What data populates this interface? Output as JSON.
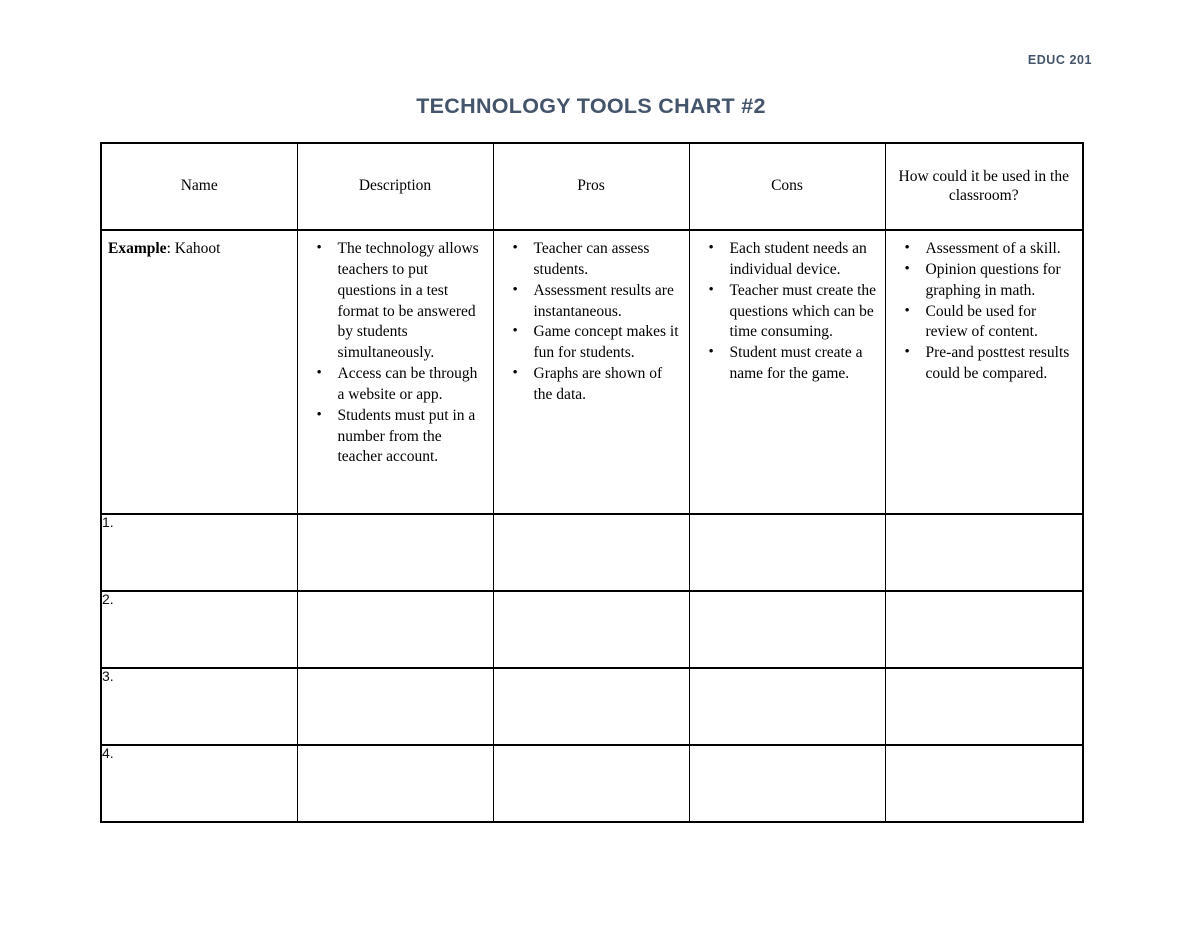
{
  "header": {
    "course_code": "EDUC 201"
  },
  "title": "TECHNOLOGY TOOLS CHART #2",
  "colors": {
    "accent": "#44546A",
    "text": "#000000",
    "border": "#000000",
    "page_background": "#FFFFFF"
  },
  "table": {
    "columns": [
      {
        "label": "Name",
        "bold": false
      },
      {
        "label": "Description",
        "bold": false
      },
      {
        "label": "Pros",
        "bold": false
      },
      {
        "label": "Cons",
        "bold": false
      },
      {
        "label": "How could it be used in the classroom?",
        "bold": true
      }
    ],
    "example_row": {
      "name_label": "Example",
      "name_separator": ": ",
      "name_value": "Kahoot",
      "description": [
        "The technology allows teachers to put questions in a test format to be answered by students simultaneously.",
        "Access can be through a website or app.",
        "Students must put in a number from the teacher account."
      ],
      "pros": [
        "Teacher can assess students.",
        "Assessment results are instantaneous.",
        "Game concept makes it fun for students.",
        "Graphs are shown of the data."
      ],
      "cons": [
        "Each student needs an individual device.",
        "Teacher must create the questions which can be time consuming.",
        "Student must create a name for the game."
      ],
      "classroom_use": [
        "Assessment of a skill.",
        "Opinion questions for graphing in math.",
        "Could be used for review of content.",
        "Pre-and posttest results could be compared."
      ]
    },
    "blank_rows": [
      {
        "number": "1.",
        "name": "",
        "description": "",
        "pros": "",
        "cons": "",
        "classroom_use": ""
      },
      {
        "number": "2.",
        "name": "",
        "description": "",
        "pros": "",
        "cons": "",
        "classroom_use": ""
      },
      {
        "number": "3.",
        "name": "",
        "description": "",
        "pros": "",
        "cons": "",
        "classroom_use": ""
      },
      {
        "number": "4.",
        "name": "",
        "description": "",
        "pros": "",
        "cons": "",
        "classroom_use": ""
      }
    ]
  }
}
